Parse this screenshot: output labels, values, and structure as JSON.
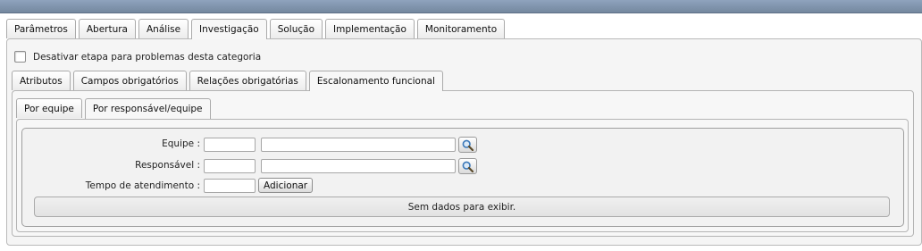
{
  "main_tabs": [
    "Parâmetros",
    "Abertura",
    "Análise",
    "Investigação",
    "Solução",
    "Implementação",
    "Monitoramento"
  ],
  "active_main_tab": "Investigação",
  "disable_stage_label": "Desativar etapa para problemas desta categoria",
  "sub_tabs": [
    "Atributos",
    "Campos obrigatórios",
    "Relações obrigatórias",
    "Escalonamento funcional"
  ],
  "active_sub_tab": "Escalonamento funcional",
  "sub2_tabs": [
    "Por equipe",
    "Por responsável/equipe"
  ],
  "active_sub2_tab": "Por responsável/equipe",
  "form": {
    "equipe_label": "Equipe :",
    "equipe_code": "",
    "equipe_name": "",
    "responsavel_label": "Responsável :",
    "responsavel_code": "",
    "responsavel_name": "",
    "tempo_label": "Tempo de atendimento :",
    "tempo_value": "",
    "add_button": "Adicionar"
  },
  "empty_message": "Sem dados para exibir.",
  "icons": {
    "lookup": "magnifier-icon"
  },
  "colors": {
    "topbar": "#7f93ad",
    "lookup_glass": "#3b78b8"
  }
}
